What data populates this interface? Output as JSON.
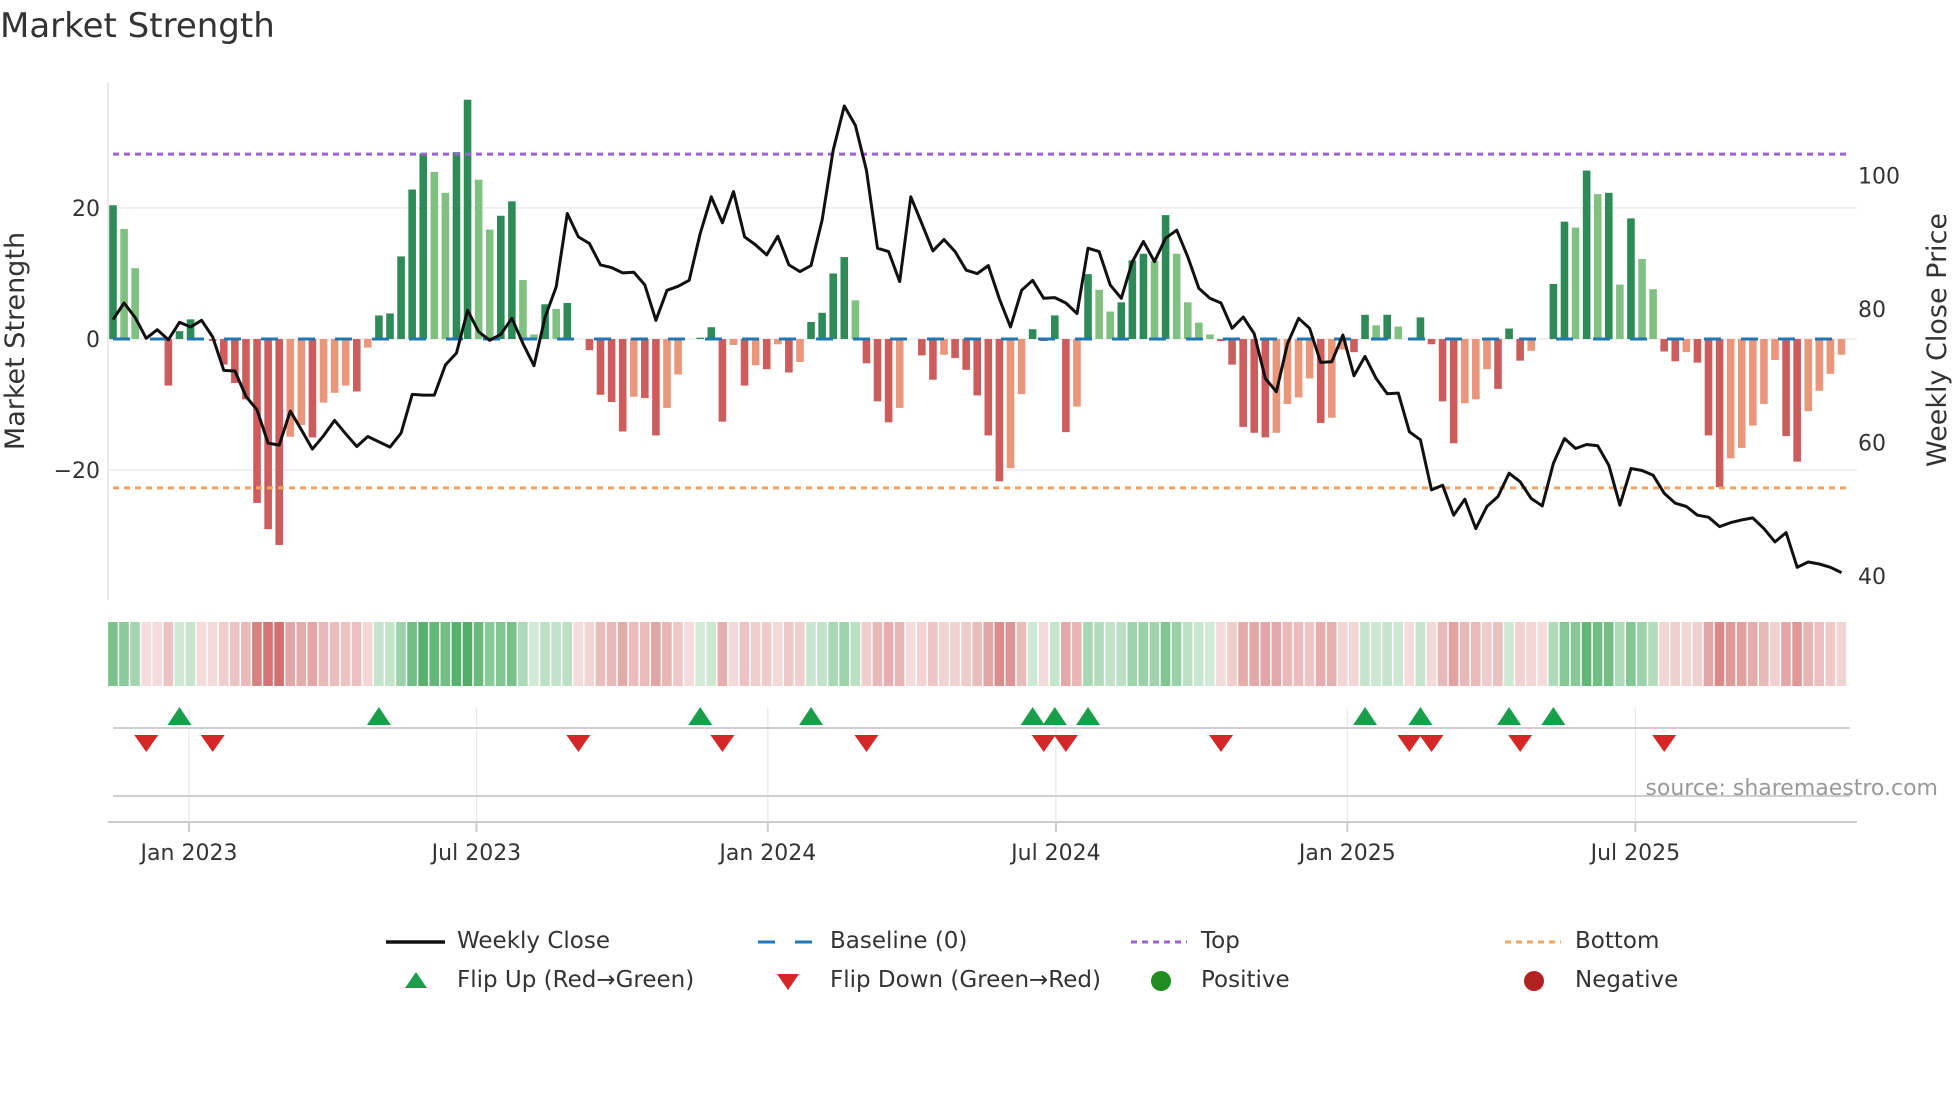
{
  "title": "Market Strength",
  "source": "source: sharemaestro.com",
  "colors": {
    "strong_green": "#2e8b57",
    "weak_green": "#80c080",
    "strong_red": "#cd5c5c",
    "weak_red": "#e9967a",
    "price_line": "#111111",
    "baseline": "#1f77b4",
    "top": "#9b5fd6",
    "bottom": "#f4a460",
    "flip_up": "#1a9e4a",
    "flip_down": "#d62728",
    "positive": "#228b22",
    "negative": "#b22222"
  },
  "legend": [
    {
      "label": "Weekly Close",
      "icon": "solid-line"
    },
    {
      "label": "Baseline (0)",
      "icon": "dashed-line"
    },
    {
      "label": "Top",
      "icon": "dotted-line"
    },
    {
      "label": "Bottom",
      "icon": "dotted-line"
    },
    {
      "label": "Flip Up (Red→Green)",
      "icon": "triangle-up"
    },
    {
      "label": "Flip Down (Green→Red)",
      "icon": "triangle-down"
    },
    {
      "label": "Positive",
      "icon": "circle"
    },
    {
      "label": "Negative",
      "icon": "circle"
    }
  ],
  "chart_data": {
    "type": "bar",
    "title": "Market Strength",
    "ylabel": "Market Strength",
    "y2label": "Weekly Close Price",
    "ylim": [
      -39.8,
      39.2
    ],
    "y2lim": [
      36.4,
      114
    ],
    "yticks": [
      {
        "value": 20,
        "label": "20"
      },
      {
        "value": 0,
        "label": "0"
      },
      {
        "value": -20,
        "label": "−20"
      }
    ],
    "y2ticks": [
      {
        "value": 100,
        "label": "100"
      },
      {
        "value": 80,
        "label": "80"
      },
      {
        "value": 60,
        "label": "60"
      },
      {
        "value": 40,
        "label": "40"
      }
    ],
    "xticks": [
      {
        "week": 6.86,
        "label": "Jan 2023"
      },
      {
        "week": 32.8,
        "label": "Jul 2023"
      },
      {
        "week": 59.1,
        "label": "Jan 2024"
      },
      {
        "week": 85.1,
        "label": "Jul 2024"
      },
      {
        "week": 111.4,
        "label": "Jan 2025"
      },
      {
        "week": 137.4,
        "label": "Jul 2025"
      }
    ],
    "top_level": 28.2,
    "bottom_level": -22.7,
    "baseline": 0,
    "strength": [
      20.4,
      16.8,
      10.8,
      0,
      0,
      -7.1,
      1.2,
      3,
      0,
      -0.3,
      -3.9,
      -6.7,
      -9.2,
      -25,
      -29,
      -31.4,
      -14.9,
      -13.1,
      -15,
      -9.7,
      -8.2,
      -7.1,
      -8,
      -1.3,
      3.6,
      3.9,
      12.6,
      22.8,
      28.3,
      25.5,
      22.3,
      28.5,
      36.5,
      24.3,
      16.7,
      18.8,
      21,
      9,
      0.7,
      5.3,
      4.6,
      5.5,
      0,
      -1.7,
      -8.5,
      -9.6,
      -14.1,
      -8.8,
      -9,
      -14.7,
      -10.5,
      -5.4,
      0,
      0.2,
      1.8,
      -12.6,
      -0.9,
      -7.1,
      -4,
      -4.6,
      -0.8,
      -5.1,
      -3.5,
      2.6,
      4,
      10,
      12.5,
      5.9,
      -3.7,
      -9.5,
      -12.7,
      -10.5,
      0,
      -2.5,
      -6.2,
      -2.4,
      -2.9,
      -4.7,
      -8.6,
      -14.7,
      -21.7,
      -19.7,
      -8.4,
      1.5,
      -0.3,
      3.6,
      -14.2,
      -10.3,
      9.9,
      7.5,
      4.2,
      5.6,
      12,
      13,
      11.9,
      18.9,
      13,
      5.6,
      2.5,
      0.7,
      -0.3,
      -3.9,
      -13.4,
      -14.3,
      -15,
      -14.3,
      -9.9,
      -8.9,
      -6,
      -12.8,
      -12,
      -1.6,
      -2,
      3.7,
      2.1,
      3.7,
      1.9,
      0,
      3.3,
      -0.8,
      -9.5,
      -15.9,
      -9.8,
      -9.2,
      -4.6,
      -7.6,
      1.6,
      -3.3,
      -1.8,
      0,
      8.4,
      17.9,
      17,
      25.7,
      22.1,
      22.3,
      8.3,
      18.4,
      12.2,
      7.6,
      -1.9,
      -3.4,
      -2,
      -3.6,
      -14.7,
      -22.6,
      -18.2,
      -16.6,
      -13.2,
      -9.9,
      -3.2,
      -14.8,
      -18.7,
      -11,
      -7.9,
      -5.3,
      -2.4
    ],
    "weekly_close": [
      78.4,
      80.9,
      78.7,
      75.6,
      76.9,
      75.4,
      78,
      77.3,
      78.3,
      75.8,
      70.8,
      70.7,
      66.9,
      64.9,
      59.9,
      59.6,
      64.7,
      61.9,
      59,
      61,
      63.3,
      61.3,
      59.4,
      60.9,
      60.1,
      59.3,
      61.4,
      67.2,
      67.1,
      67.1,
      71.6,
      73.4,
      79.8,
      76.6,
      75.3,
      76.2,
      78.6,
      74.8,
      71.5,
      78.8,
      83.3,
      94.3,
      90.8,
      89.8,
      86.6,
      86.2,
      85.4,
      85.5,
      83.6,
      78.3,
      82.8,
      83.4,
      84.3,
      91.3,
      96.8,
      92.9,
      97.6,
      90.8,
      89.6,
      88.1,
      90.9,
      86.6,
      85.6,
      86.5,
      93.3,
      103.8,
      110.4,
      107.5,
      100.8,
      89.1,
      88.6,
      84.1,
      96.8,
      92.8,
      88.7,
      90.4,
      88.6,
      85.8,
      85.3,
      86.5,
      81.5,
      77.3,
      82.8,
      84.3,
      81.6,
      81.7,
      80.9,
      79.3,
      89.1,
      88.6,
      83.6,
      81.6,
      87.1,
      90.1,
      87.1,
      90.6,
      91.8,
      87.8,
      83.1,
      81.6,
      80.9,
      77.1,
      78.8,
      76.3,
      69.6,
      67.6,
      74.8,
      78.6,
      77.1,
      72,
      72.1,
      76.1,
      70,
      72.9,
      69.6,
      67.3,
      67.4,
      61.6,
      60.4,
      52.9,
      53.6,
      49.1,
      51.5,
      47.1,
      50.4,
      51.9,
      55.4,
      54.1,
      51.6,
      50.5,
      56.9,
      60.6,
      59.1,
      59.7,
      59.5,
      56.6,
      50.6,
      56.1,
      55.8,
      55.1,
      52.4,
      50.9,
      50.4,
      49.1,
      48.8,
      47.4,
      48,
      48.4,
      48.7,
      47.1,
      45.1,
      46.5,
      41.3,
      42.1,
      41.8,
      41.3,
      40.5
    ],
    "flip_up_weeks": [
      7,
      25,
      54,
      64,
      84,
      86,
      89,
      114,
      119,
      127,
      131
    ],
    "flip_down_weeks": [
      4,
      10,
      43,
      56,
      69,
      85,
      87,
      101,
      118,
      120,
      128,
      141
    ],
    "grid": true,
    "legend_position": "bottom"
  }
}
